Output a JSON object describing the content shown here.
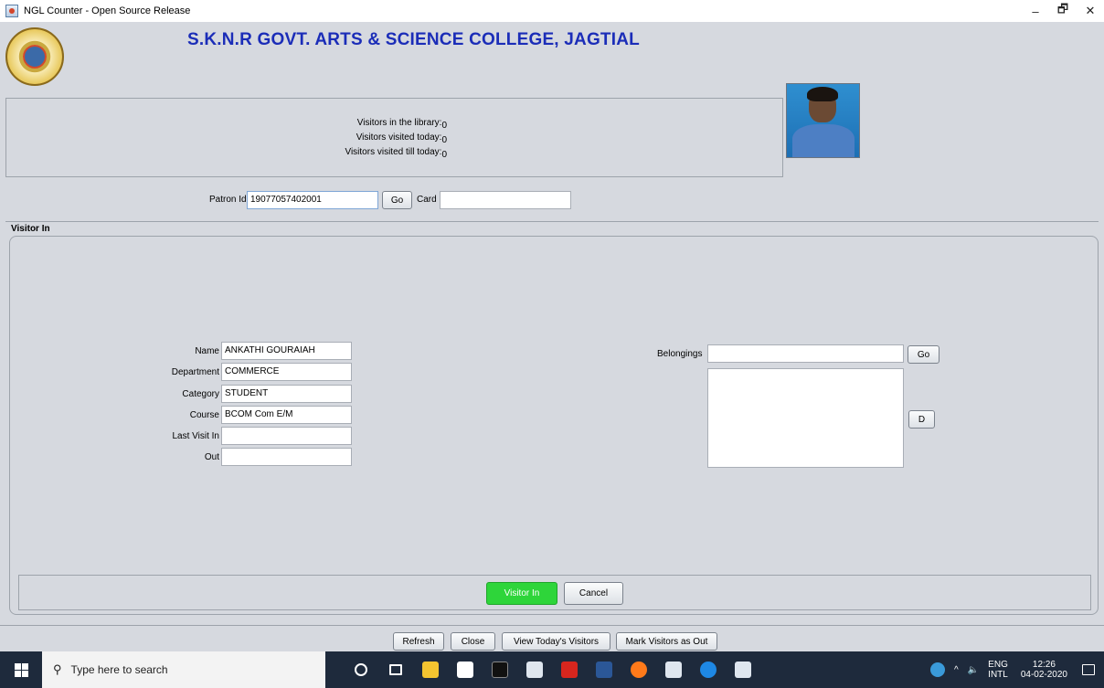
{
  "window": {
    "title": "NGL Counter - Open Source Release",
    "minimize": "–",
    "restore": "🗗",
    "close": "✕"
  },
  "header": {
    "college_name": "S.K.N.R GOVT. ARTS & SCIENCE COLLEGE, JAGTIAL"
  },
  "stats": {
    "in_library_label": "Visitors in the library:",
    "in_library_value": "0",
    "visited_today_label": "Visitors visited today:",
    "visited_today_value": "0",
    "visited_till_label": "Visitors visited till today:",
    "visited_till_value": "0"
  },
  "patron": {
    "patron_id_label": "Patron Id",
    "patron_id_value": "19077057402001",
    "go_label": "Go",
    "card_label": "Card",
    "card_value": ""
  },
  "visitor_in": {
    "section_title": "Visitor In",
    "name_label": "Name",
    "name_value": "ANKATHI GOURAIAH",
    "department_label": "Department",
    "department_value": "COMMERCE",
    "category_label": "Category",
    "category_value": "STUDENT",
    "course_label": "Course",
    "course_value": "BCOM Com E/M",
    "last_visit_label": "Last Visit In",
    "last_visit_value": "",
    "out_label": "Out",
    "out_value": "",
    "belongings_label": "Belongings",
    "belongings_value": "",
    "belongings_go_label": "Go",
    "delete_label": "D",
    "visitor_in_button": "Visitor In",
    "cancel_button": "Cancel"
  },
  "bottom": {
    "refresh": "Refresh",
    "close": "Close",
    "view_today": "View Today's Visitors",
    "mark_out": "Mark Visitors as Out"
  },
  "taskbar": {
    "search_placeholder": "Type here to search",
    "lang_top": "ENG",
    "lang_bottom": "INTL",
    "time": "12:26",
    "date": "04-02-2020",
    "icons": [
      "cortana-icon",
      "task-view-icon",
      "file-explorer-icon",
      "store-icon",
      "terminal-icon",
      "java-icon",
      "acrobat-icon",
      "word-icon",
      "firefox-icon",
      "java-icon",
      "edge-icon",
      "java-icon"
    ]
  },
  "colors": {
    "college_title": "#1b2db8",
    "visitor_in_button": "#2ed53a",
    "taskbar": "#1e2a3c"
  }
}
